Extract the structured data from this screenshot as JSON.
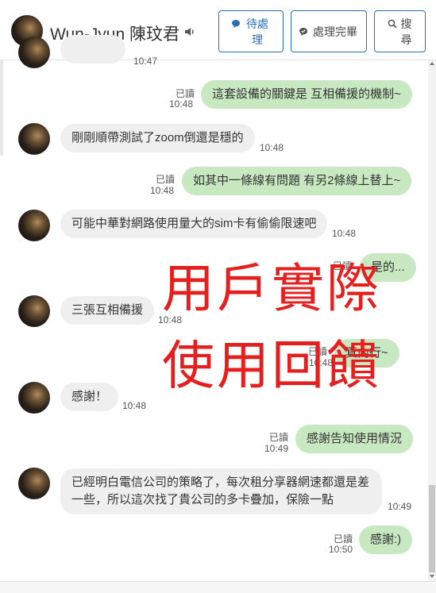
{
  "header": {
    "contact_name": "Wun-Jyun 陳玟君",
    "buttons": {
      "pending": "待處理",
      "done": "處理完畢",
      "search": "搜尋"
    }
  },
  "messages": [
    {
      "dir": "in",
      "text": "",
      "time": "10:47"
    },
    {
      "dir": "out",
      "text": "這套設備的關鍵是 互相備援的機制~",
      "read": "已讀",
      "time": "10:48"
    },
    {
      "dir": "in",
      "text": "剛剛順帶測試了zoom倒還是穩的",
      "time": "10:48"
    },
    {
      "dir": "out",
      "text": "如其中一條線有問題 有另2條線上替上~",
      "read": "已讀",
      "time": "10:48"
    },
    {
      "dir": "in",
      "text": "可能中華對網路使用量大的sim卡有偷偷限速吧",
      "time": "10:48"
    },
    {
      "dir": "out",
      "text": "是的...",
      "read": "已讀",
      "time": ""
    },
    {
      "dir": "in",
      "text": "三張互相備援",
      "time": "10:48"
    },
    {
      "dir": "out",
      "text": "真內行~",
      "read": "已讀",
      "time": "10:48"
    },
    {
      "dir": "in",
      "text": "感謝！",
      "time": "10:48"
    },
    {
      "dir": "out",
      "text": "感謝告知使用情況",
      "read": "已讀",
      "time": "10:49"
    },
    {
      "dir": "in",
      "text": "已經明白電信公司的策略了，每次租分享器網速都還是差一些，所以這次找了貴公司的多卡疊加，保險一點",
      "time": "10:49"
    },
    {
      "dir": "out",
      "text": "感謝:)",
      "read": "已讀",
      "time": "10:50"
    }
  ],
  "overlay": {
    "line1": "用戶實際",
    "line2": "使用回饋"
  },
  "colors": {
    "accent": "#2b6fb6",
    "bubble_out": "#c7e8c0",
    "bubble_in": "#efefef",
    "overlay": "#e61e1e"
  },
  "icons": [
    "speaker-icon",
    "chat-bubble-icon",
    "check-bubble-icon",
    "search-icon"
  ]
}
